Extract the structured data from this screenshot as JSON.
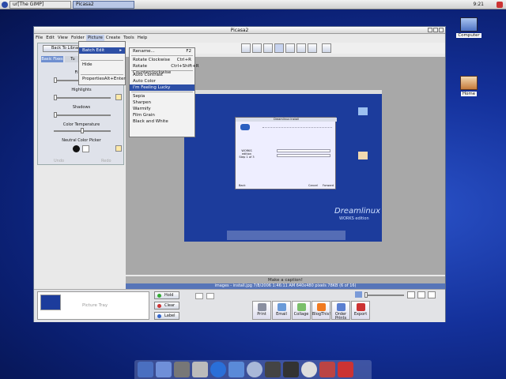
{
  "panel": {
    "tasks": [
      "ur[The GIMP]",
      "Picasa2"
    ],
    "clock": "9:21"
  },
  "desktop": {
    "icons": [
      "Computer",
      "Home"
    ]
  },
  "window": {
    "title": "Picasa2",
    "menus": [
      "File",
      "Edit",
      "View",
      "Folder",
      "Picture",
      "Create",
      "Tools",
      "Help"
    ]
  },
  "left_panel": {
    "back_label": "Back To Library",
    "tabs": [
      "Basic Fixes",
      "Tu"
    ],
    "fill_label": "Fill",
    "highlights_label": "Highlights",
    "shadows_label": "Shadows",
    "color_temp_label": "Color Temperature",
    "neutral_label": "Neutral Color Picker",
    "undo": "Undo",
    "redo": "Redo"
  },
  "picture_menu": {
    "items": [
      "Batch Edit",
      "Hide",
      "Properties"
    ],
    "properties_shortcut": "Alt+Enter"
  },
  "batch_menu": {
    "rename": "Rename...",
    "rename_key": "F2",
    "rotate_cw": "Rotate Clockwise",
    "rotate_cw_key": "Ctrl+R",
    "rotate_ccw": "Rotate Counterclockwise",
    "rotate_ccw_key": "Ctrl+Shift+R",
    "auto_contrast": "Auto Contrast",
    "auto_color": "Auto Color",
    "lucky": "I'm Feeling Lucky",
    "sepia": "Sepia",
    "sharpen": "Sharpen",
    "warmify": "Warmify",
    "film_grain": "Film Grain",
    "bw": "Black and White"
  },
  "viewer": {
    "caption": "Make a caption!",
    "info": "images - install.jpg    7/8/2006 1:46:11 AM    640x480 pixels    78KB    (6 of 16)"
  },
  "inner_screenshot": {
    "dialog_title": "Dreamlinux Install",
    "step_title": "WORKS edition",
    "step": "Step 1 of 3",
    "back": "Back",
    "cancel": "Cancel",
    "forward": "Forward",
    "brand": "Dreamlinux",
    "brand_sub": "WORKS edition"
  },
  "bottom": {
    "tray_label": "Picture Tray",
    "hold": "Hold",
    "clear": "Clear",
    "label": "Label",
    "actions": [
      "Print",
      "Email",
      "Collage",
      "BlogThis!",
      "Order Prints",
      "Export"
    ]
  },
  "colors": {
    "selection": "#2d4fa6",
    "desktop": "#14319b"
  }
}
